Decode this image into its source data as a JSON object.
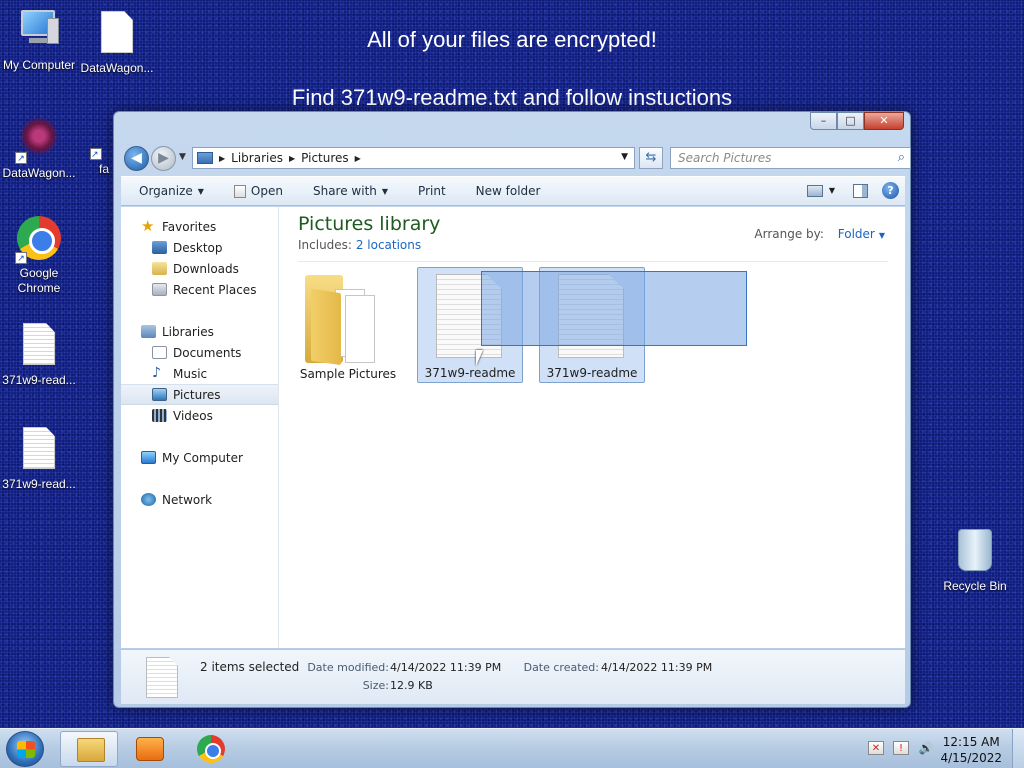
{
  "desktop": {
    "message_line1": "All of your files are encrypted!",
    "message_line2": "Find 371w9-readme.txt and follow instuctions",
    "icons": [
      {
        "label": "My Computer",
        "icon": "computer-icon"
      },
      {
        "label": "DataWagon...",
        "icon": "document-icon"
      },
      {
        "label": "DataWagon...",
        "icon": "shortcut-icon"
      },
      {
        "label": "fa",
        "icon": "shortcut-icon"
      },
      {
        "label": "Google Chrome",
        "icon": "chrome-icon"
      },
      {
        "label": "371w9-read...",
        "icon": "text-file-icon"
      },
      {
        "label": "371w9-read...",
        "icon": "text-file-icon"
      },
      {
        "label": "Recycle Bin",
        "icon": "recycle-bin-icon"
      }
    ]
  },
  "window": {
    "caption_buttons": {
      "minimize": "–",
      "maximize": "□",
      "close": "✕"
    },
    "breadcrumb": [
      "Libraries",
      "Pictures"
    ],
    "search_placeholder": "Search Pictures",
    "toolbar": {
      "organize": "Organize",
      "open": "Open",
      "share_with": "Share with",
      "print": "Print",
      "new_folder": "New folder"
    },
    "nav_pane": {
      "favorites": "Favorites",
      "desktop": "Desktop",
      "downloads": "Downloads",
      "recent_places": "Recent Places",
      "libraries": "Libraries",
      "documents": "Documents",
      "music": "Music",
      "pictures": "Pictures",
      "videos": "Videos",
      "my_computer": "My Computer",
      "network": "Network"
    },
    "library": {
      "title": "Pictures library",
      "includes_label": "Includes:",
      "includes_link": "2 locations",
      "arrange_label": "Arrange by:",
      "arrange_value": "Folder"
    },
    "items": [
      {
        "label": "Sample Pictures",
        "type": "folder",
        "selected": false
      },
      {
        "label": "371w9-readme",
        "type": "text-file",
        "selected": true
      },
      {
        "label": "371w9-readme",
        "type": "text-file",
        "selected": true
      }
    ],
    "details": {
      "count": "2 items selected",
      "date_modified_label": "Date modified:",
      "date_modified": "4/14/2022 11:39 PM",
      "date_created_label": "Date created:",
      "date_created": "4/14/2022 11:39 PM",
      "size_label": "Size:",
      "size": "12.9 KB"
    }
  },
  "taskbar": {
    "apps": [
      {
        "name": "Windows Explorer",
        "icon": "explorer-icon",
        "active": true
      },
      {
        "name": "Windows Media Player",
        "icon": "media-player-icon",
        "active": false
      },
      {
        "name": "Google Chrome",
        "icon": "chrome-icon",
        "active": false
      }
    ],
    "clock_time": "12:15 AM",
    "clock_date": "4/15/2022"
  }
}
